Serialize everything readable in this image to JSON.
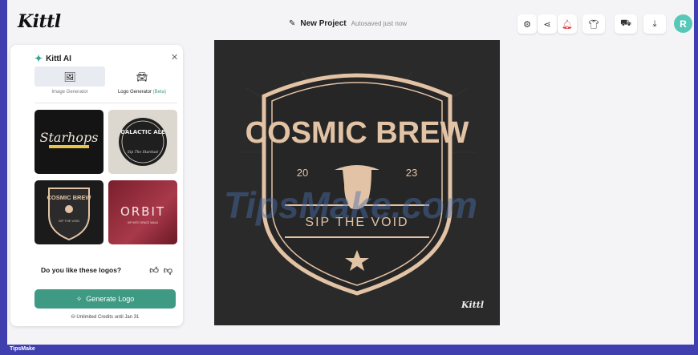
{
  "app": {
    "logo_text": "Kittl"
  },
  "project": {
    "name": "New Project",
    "status": "Autosaved just now"
  },
  "user": {
    "avatar_initial": "R"
  },
  "panel": {
    "title": "Kittl AI",
    "tabs": [
      {
        "label": "Image Generator",
        "icon": "image-icon",
        "active": false
      },
      {
        "label": "Logo Generator",
        "badge": "(Beta)",
        "icon": "car-icon",
        "active": true
      }
    ],
    "results": [
      {
        "text": "Starhops"
      },
      {
        "text": "GALACTIC ALE",
        "subtext": "Sip The Stardust"
      },
      {
        "text": "COSMIC BREW",
        "subtext": "SIP THE VOID"
      },
      {
        "text": "ORBIT",
        "subtext": "SIP INTO SPACE WALK"
      }
    ],
    "feedback_question": "Do you like these logos?",
    "generate_label": "Generate Logo",
    "credits_text": "Unlimited Credits until Jan 31"
  },
  "canvas_logo": {
    "title": "COSMIC BREW",
    "year_left": "20",
    "year_right": "23",
    "tagline": "SIP THE VOID",
    "badge": "Kittl",
    "watermark": "TipsMake.com"
  },
  "footer_watermark": "TipsMake",
  "colors": {
    "accent": "#3f9a84",
    "frame": "#3f3fb0",
    "avatar": "#57c8b8",
    "logo_tan": "#e3c3a5"
  }
}
